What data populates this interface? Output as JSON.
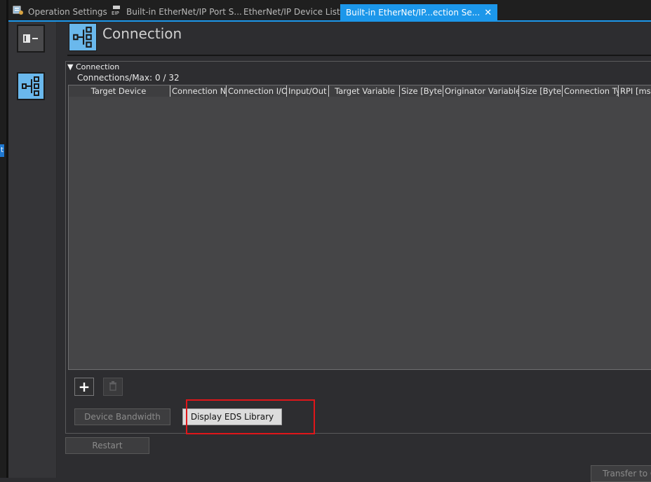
{
  "tabs": [
    {
      "label": "Operation Settings",
      "icon": "operation-settings-icon"
    },
    {
      "label": "Built-in EtherNet/IP Port S...",
      "icon": "eip-port-icon"
    },
    {
      "label": "EtherNet/IP Device List"
    },
    {
      "label": "Built-in EtherNet/IP...ection Se...",
      "active": true,
      "close": "✕"
    }
  ],
  "edge_tab_label": "t",
  "header": {
    "title": "Connection"
  },
  "section": {
    "title": "▼ Connection"
  },
  "connections": {
    "label": "Connections/Max:",
    "value": "0 / 32"
  },
  "table": {
    "columns": [
      "Target Device",
      "Connection Na",
      "Connection I/O",
      "Input/Out",
      "Target Variable",
      "Size [Byte]",
      "Originator Variable",
      "Size [Byte]",
      "Connection Ty",
      "RPI [ms]"
    ],
    "rows": []
  },
  "buttons": {
    "add": "+",
    "delete": "🗑",
    "device_bandwidth": "Device Bandwidth",
    "display_eds": "Display EDS Library",
    "restart": "Restart",
    "transfer": "Transfer to C"
  },
  "colors": {
    "accent": "#1c97ea",
    "highlight": "#e0161a",
    "icon_fill": "#6ab8ec"
  }
}
